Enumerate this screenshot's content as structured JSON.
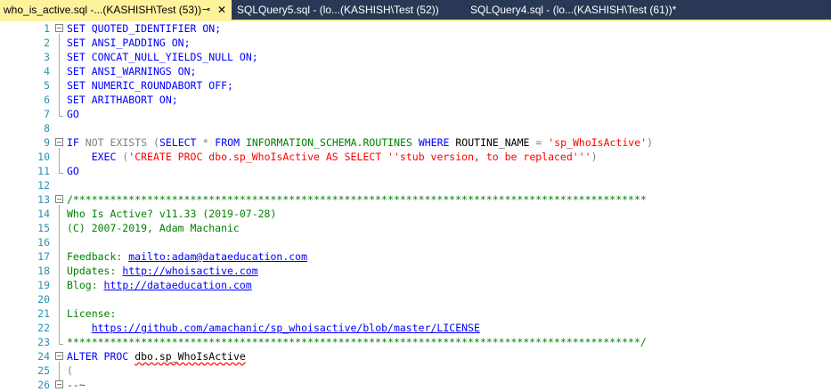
{
  "tabs": [
    {
      "label": "who_is_active.sql -...(KASHISH\\Test (53))",
      "active": true
    },
    {
      "label": "SQLQuery5.sql - (lo...(KASHISH\\Test (52))",
      "active": false
    },
    {
      "label": "SQLQuery4.sql - (lo...(KASHISH\\Test (61))*",
      "active": false
    }
  ],
  "icons": {
    "pin": "pin-icon",
    "close": "close-icon"
  },
  "line_numbers": [
    "1",
    "2",
    "3",
    "4",
    "5",
    "6",
    "7",
    "8",
    "9",
    "10",
    "11",
    "12",
    "13",
    "14",
    "15",
    "16",
    "17",
    "18",
    "19",
    "20",
    "21",
    "22",
    "23",
    "24",
    "25",
    "26"
  ],
  "code": {
    "l1_kw": "SET",
    "l1_opt": "QUOTED_IDENTIFIER",
    "l1_val": "ON;",
    "l2_kw": "SET",
    "l2_opt": "ANSI_PADDING",
    "l2_val": "ON;",
    "l3_kw": "SET",
    "l3_opt": "CONCAT_NULL_YIELDS_NULL",
    "l3_val": "ON;",
    "l4_kw": "SET",
    "l4_opt": "ANSI_WARNINGS",
    "l4_val": "ON;",
    "l5_kw": "SET",
    "l5_opt": "NUMERIC_ROUNDABORT",
    "l5_val": "OFF;",
    "l6_kw": "SET",
    "l6_opt": "ARITHABORT",
    "l6_val": "ON;",
    "l7": "GO",
    "l9_if": "IF",
    "l9_not": "NOT",
    "l9_exists": "EXISTS",
    "l9_open": "(",
    "l9_select": "SELECT",
    "l9_star": "*",
    "l9_from": "FROM",
    "l9_schema": "INFORMATION_SCHEMA.ROUTINES",
    "l9_where": "WHERE",
    "l9_col": "ROUTINE_NAME",
    "l9_eq": "=",
    "l9_str": "'sp_WhoIsActive'",
    "l9_close": ")",
    "l10_exec": "EXEC",
    "l10_open": "(",
    "l10_str": "'CREATE PROC dbo.sp_WhoIsActive AS SELECT ''stub version, to be replaced'''",
    "l10_close": ")",
    "l11": "GO",
    "l13": "/*********************************************************************************************",
    "l14": "Who Is Active? v11.33 (2019-07-28)",
    "l15": "(C) 2007-2019, Adam Machanic",
    "l17_label": "Feedback: ",
    "l17_link": "mailto:adam@dataeducation.com",
    "l18_label": "Updates: ",
    "l18_link": "http://whoisactive.com",
    "l19_label": "Blog: ",
    "l19_link": "http://dataeducation.com",
    "l21": "License:",
    "l22_link": "https://github.com/amachanic/sp_whoisactive/blob/master/LICENSE",
    "l23": "*********************************************************************************************/",
    "l24_kw": "ALTER PROC",
    "l24_name": "dbo.sp_WhoIsActive",
    "l25": "(",
    "l26": "--~"
  }
}
